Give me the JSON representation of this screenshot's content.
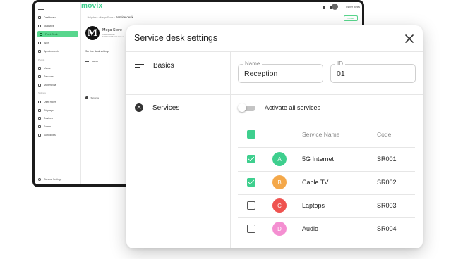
{
  "background_app": {
    "logo": "movix",
    "sidebar": {
      "items": [
        {
          "label": "Dashboard"
        },
        {
          "label": "Statistics"
        },
        {
          "label": "Front Desk",
          "active": true
        },
        {
          "label": "Apps"
        },
        {
          "label": "Appointments"
        }
      ],
      "section_people": "People",
      "people_items": [
        {
          "label": "Users"
        },
        {
          "label": "Services"
        },
        {
          "label": "Multimedia"
        }
      ],
      "section_settings": "Settings",
      "settings_items": [
        {
          "label": "User Roles"
        },
        {
          "label": "Displays"
        },
        {
          "label": "Devices"
        },
        {
          "label": "Forms"
        },
        {
          "label": "Schedules"
        }
      ],
      "general_settings": "General Settings"
    },
    "user_name": "Esther Jones",
    "breadcrumb": {
      "part1": "Helpdesk",
      "part2": "Mega Store",
      "current": "Service desk"
    },
    "save_label": "Update",
    "store": {
      "name": "Mega Store",
      "logo_letter": "M",
      "meta_line1": "Code     Address",
      "meta_line2": "SR007    2205 Oak Street"
    },
    "panel_title": "Service desk settings",
    "panel_rows": [
      {
        "label": "Basics"
      },
      {
        "label": "Services"
      }
    ]
  },
  "modal": {
    "title": "Service desk settings",
    "nav": {
      "basics": "Basics",
      "services": "Services",
      "services_icon_letter": "A"
    },
    "name_field": {
      "label": "Name",
      "value": "Reception"
    },
    "id_field": {
      "label": "ID",
      "value": "01"
    },
    "activate_all": {
      "label": "Activate all services",
      "on": false
    },
    "table": {
      "headers": {
        "name": "Service Name",
        "code": "Code"
      },
      "rows": [
        {
          "letter": "A",
          "name": "5G Internet",
          "code": "SR001",
          "checked": true,
          "color": "#3ecf8e"
        },
        {
          "letter": "B",
          "name": "Cable TV",
          "code": "SR002",
          "checked": true,
          "color": "#f4a84a"
        },
        {
          "letter": "C",
          "name": "Laptops",
          "code": "SR003",
          "checked": false,
          "color": "#ef5350"
        },
        {
          "letter": "D",
          "name": "Audio",
          "code": "SR004",
          "checked": false,
          "color": "#f48fd1"
        }
      ]
    }
  },
  "colors": {
    "accent": "#3ecf8e",
    "tablet_frame": "#1b1b1b"
  }
}
